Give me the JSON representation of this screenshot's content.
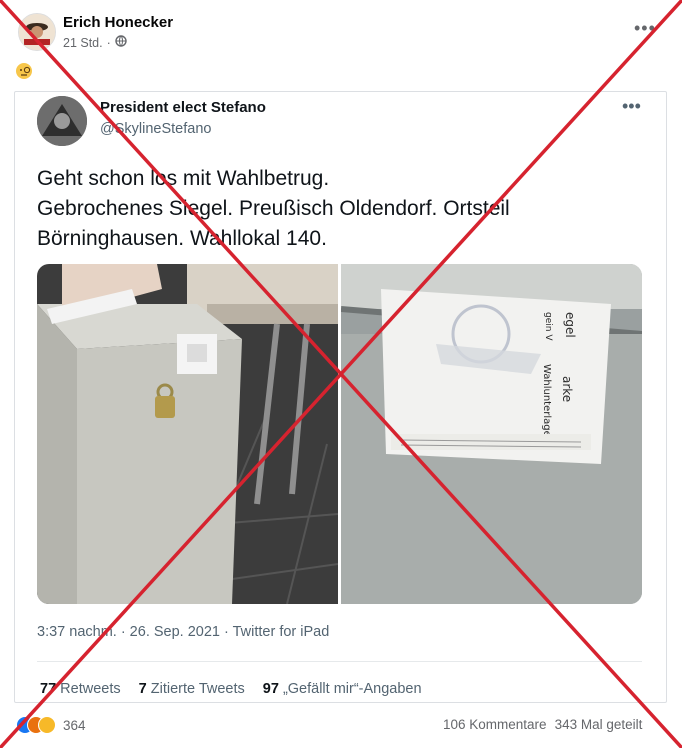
{
  "post": {
    "author": "Erich Honecker",
    "time": "21 Std.",
    "audience_icon": "globe-icon",
    "reaction_emoji": "monocle-face-emoji"
  },
  "tweet": {
    "display_name": "President elect Stefano",
    "handle": "@SkylineStefano",
    "text_lines": [
      "Geht schon los mit Wahlbetrug.",
      "Gebrochenes Siegel. Preußisch Oldendorf. Ortsteil",
      "Börninghausen. Wahllokal 140."
    ],
    "timestamp": "3:37 nachm. · 26. Sep. 2021 · Twitter for iPad",
    "stats": {
      "retweets_count": "77",
      "retweets_label": "Retweets",
      "quotes_count": "7",
      "quotes_label": "Zitierte Tweets",
      "likes_count": "97",
      "likes_label": "„Gefällt mir“-Angaben"
    },
    "seal_texts": [
      "egel",
      "gein V",
      "arke",
      "Wahlunterlagen"
    ]
  },
  "footer": {
    "reaction_count": "364",
    "comments": "106 Kommentare",
    "shares": "343 Mal geteilt"
  },
  "colors": {
    "fact_check_cross": "#d6232f",
    "twitter_gray": "#536471",
    "facebook_gray": "#65676b"
  }
}
